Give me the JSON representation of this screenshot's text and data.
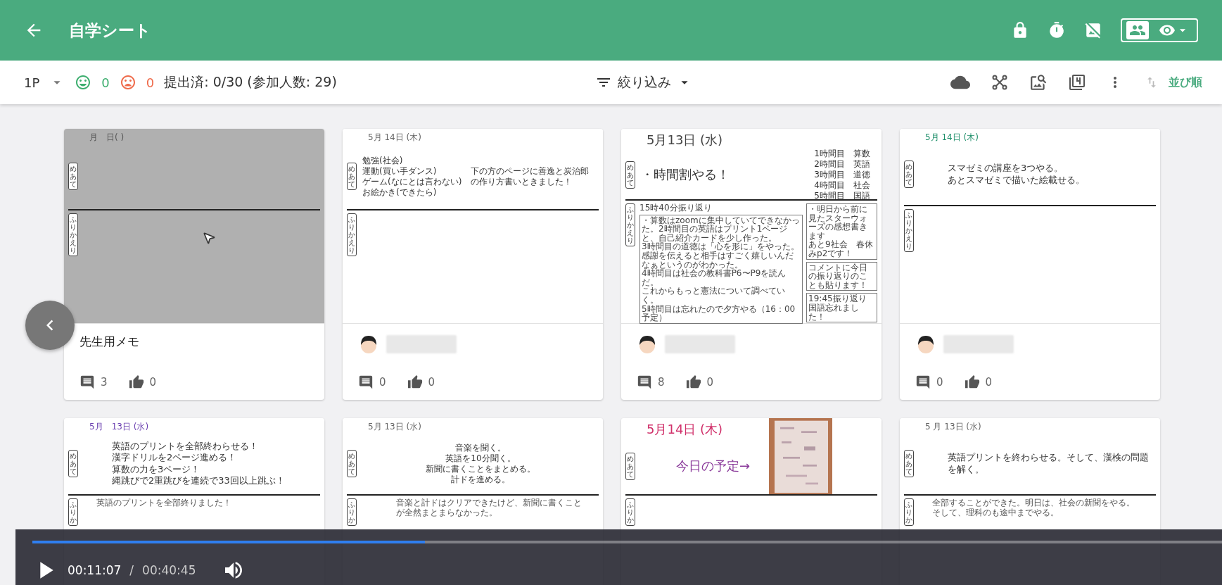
{
  "header": {
    "title": "自学シート"
  },
  "toolbar": {
    "page": "1P",
    "good_count": "0",
    "bad_count": "0",
    "submitted": "提出済: 0/30 (参加人数: 29)",
    "filter": "絞り込み",
    "sort": "並び順"
  },
  "cards": [
    {
      "kind": "memo",
      "footer_title": "先生用メモ",
      "comments": "3",
      "likes": "0",
      "sheet": {
        "kind": "blank",
        "date": {
          "text": "月　日( )",
          "color": "#555555"
        },
        "goal_label": "めあて",
        "reflection_label": "ふりかえり"
      }
    },
    {
      "kind": "student",
      "comments": "0",
      "likes": "0",
      "sheet": {
        "kind": "list",
        "date": {
          "text": "5月 14日 (木)",
          "color": "#666666"
        },
        "goal_label": "めあて",
        "reflection_label": "ふりかえり",
        "goal": [
          "勉強(社会)",
          "運動(買い手ダンス)",
          "ゲーム(なにとは言わない)",
          "お絵かき(できたら)"
        ],
        "side": [
          "下の方のページに善逸と炭治郎の作り方書いときました！"
        ]
      }
    },
    {
      "kind": "student",
      "comments": "8",
      "likes": "0",
      "sheet": {
        "kind": "timetable",
        "date": {
          "text": "5月13日 (水)",
          "color": "#444444"
        },
        "goal_label": "めあて",
        "reflection_label": "ふりかえり",
        "goal": [
          "・時間割やる！"
        ],
        "side": [
          "1時間目　算数",
          "2時間目　英語",
          "3時間目　道徳",
          "4時間目　社会",
          "5時間目　国語"
        ],
        "reflection": [
          [
            {
              "boxed": false,
              "lines": [
                "15時40分振り返り"
              ]
            },
            {
              "boxed": true,
              "lines": [
                "・算数はzoomに集中していてできなかった。2時間目の英語はプリント1ページと、自己紹介カードを少し作った。",
                "3時間目の道徳は「心を形に」をやった。感謝を伝えると相手はすごく嬉しいんだなぁというのがわかった。",
                "4時間目は社会の教科書P6〜P9を読んだ。",
                "これからもっと憲法について調べていく。",
                "5時間目は忘れたので夕方やる（16：00予定）"
              ]
            }
          ],
          [
            {
              "boxed": true,
              "lines": [
                "・明日から前に見たスターウォーズの感想書きます",
                "あと9社会　春休みp2です！"
              ]
            },
            {
              "boxed": true,
              "lines": [
                "コメントに今日の振り返りのことも貼ります！"
              ]
            },
            {
              "boxed": true,
              "lines": [
                "19:45振り返り",
                "国語忘れました！"
              ]
            }
          ]
        ]
      }
    },
    {
      "kind": "student",
      "comments": "0",
      "likes": "0",
      "sheet": {
        "kind": "typed",
        "date": {
          "text": "5月 14日 (木)",
          "color": "#1f8f6a"
        },
        "goal_label": "めあて",
        "reflection_label": "ふりかえり",
        "goal": [
          "スマゼミの講座を3つやる。",
          "あとスマゼミで描いた絵載せる。"
        ]
      }
    },
    {
      "kind": "student",
      "sheet": {
        "kind": "typed",
        "date": {
          "text": "5月　13日 (水)",
          "color": "#6a3fb0"
        },
        "goal_label": "めあて",
        "reflection_label": "ふりか",
        "goal": [
          "英語のプリントを全部終わらせる！",
          "漢字ドリルを2ページ進める！",
          "算数の力を3ページ！",
          "縄跳びで2重跳びを連続で33回以上跳ぶ！"
        ],
        "reflection": [
          [
            {
              "boxed": false,
              "lines": [
                "英語のプリントを全部終りました！"
              ]
            }
          ]
        ]
      }
    },
    {
      "kind": "student",
      "sheet": {
        "kind": "centered",
        "date": {
          "text": "5月 13日 (水)",
          "color": "#666666"
        },
        "goal_label": "めあて",
        "reflection_label": "ふりか",
        "goal": [
          "音楽を聞く。",
          "英語を10分聞く。",
          "新聞に書くことをまとめる。",
          "計ドを進める。"
        ],
        "reflection": [
          [
            {
              "boxed": false,
              "lines": [
                "音楽と計ドはクリアできたけど、新聞に書くことが全然まとまらなかった。"
              ]
            }
          ]
        ]
      }
    },
    {
      "kind": "student",
      "sheet": {
        "date": {
          "text": "5月14日 (木)",
          "color": "#d0306a"
        },
        "goal_label": "めあて",
        "reflection_label": "ふりか",
        "goal": [
          "今日の予定→"
        ]
      }
    },
    {
      "kind": "student",
      "sheet": {
        "kind": "typed",
        "date": {
          "text": "5 月 13日 (水)",
          "color": "#666666"
        },
        "goal_label": "めあて",
        "reflection_label": "ふりか",
        "goal": [
          "英語プリントを終わらせる。そして、漢検の問題を解く。"
        ],
        "reflection": [
          [
            {
              "boxed": false,
              "lines": [
                "全部することができた。明日は、社会の新聞をやる。そして、理科のも途中までやる。"
              ]
            }
          ]
        ]
      }
    }
  ],
  "player": {
    "current": "00:11:07",
    "separator": "/",
    "duration": "00:40:45",
    "progress": {
      "level": 0.33
    }
  }
}
